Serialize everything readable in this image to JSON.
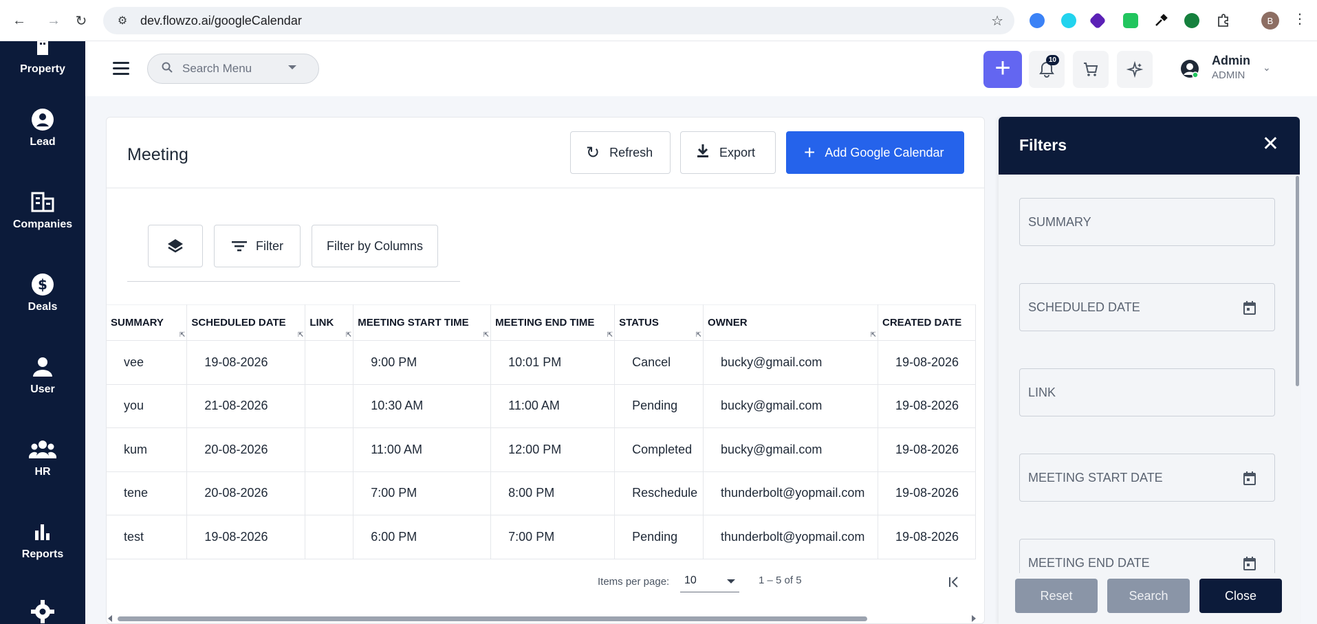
{
  "browser": {
    "url": "dev.flowzo.ai/googleCalendar",
    "profile_initial": "B"
  },
  "sidebar": {
    "items": [
      {
        "label": "Property",
        "icon": "building-icon"
      },
      {
        "label": "Lead",
        "icon": "person-circle-icon"
      },
      {
        "label": "Companies",
        "icon": "companies-icon"
      },
      {
        "label": "Deals",
        "icon": "dollar-icon"
      },
      {
        "label": "User",
        "icon": "user-icon"
      },
      {
        "label": "HR",
        "icon": "group-icon"
      },
      {
        "label": "Reports",
        "icon": "bar-chart-icon"
      },
      {
        "label": "",
        "icon": "gear-icon"
      }
    ]
  },
  "header": {
    "search_placeholder": "Search Menu",
    "notifications_count": "10",
    "user_name": "Admin",
    "user_role": "ADMIN"
  },
  "page": {
    "title": "Meeting",
    "refresh_label": "Refresh",
    "export_label": "Export",
    "add_label": "Add Google Calendar",
    "filter_label": "Filter",
    "filter_columns_label": "Filter by Columns"
  },
  "table": {
    "columns": [
      "SUMMARY",
      "SCHEDULED DATE",
      "LINK",
      "MEETING START TIME",
      "MEETING END TIME",
      "STATUS",
      "OWNER",
      "CREATED DATE"
    ],
    "rows": [
      [
        "vee",
        "19-08-2026",
        "",
        "9:00 PM",
        "10:01 PM",
        "Cancel",
        "bucky@gmail.com",
        "19-08-2026"
      ],
      [
        "you",
        "21-08-2026",
        "",
        "10:30 AM",
        "11:00 AM",
        "Pending",
        "bucky@gmail.com",
        "19-08-2026"
      ],
      [
        "kum",
        "20-08-2026",
        "",
        "11:00 AM",
        "12:00 PM",
        "Completed",
        "bucky@gmail.com",
        "19-08-2026"
      ],
      [
        "tene",
        "20-08-2026",
        "",
        "7:00 PM",
        "8:00 PM",
        "Reschedule",
        "thunderbolt@yopmail.com",
        "19-08-2026"
      ],
      [
        "test",
        "19-08-2026",
        "",
        "6:00 PM",
        "7:00 PM",
        "Pending",
        "thunderbolt@yopmail.com",
        "19-08-2026"
      ]
    ]
  },
  "pagination": {
    "items_per_page_label": "Items per page:",
    "items_per_page": "10",
    "range": "1 – 5 of 5"
  },
  "filters": {
    "title": "Filters",
    "fields": [
      "SUMMARY",
      "SCHEDULED DATE",
      "LINK",
      "MEETING START DATE",
      "MEETING END DATE"
    ],
    "reset_label": "Reset",
    "search_label": "Search",
    "close_label": "Close"
  },
  "colors": {
    "sidebar_bg": "#0c1b3a",
    "primary": "#2563eb",
    "accent_plus": "#6366f1"
  }
}
